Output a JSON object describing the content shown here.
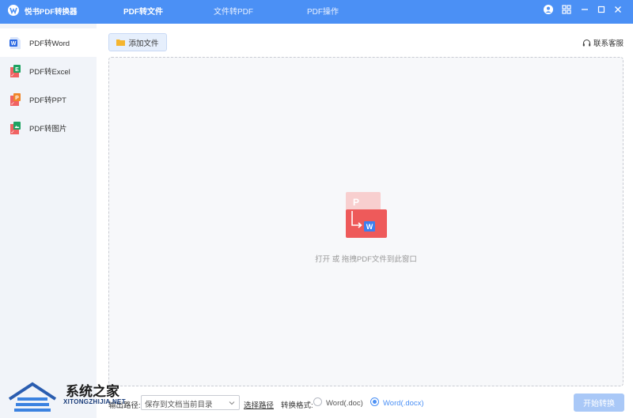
{
  "app": {
    "title": "悦书PDF转换器",
    "accent_color": "#4b90f5"
  },
  "tabs": [
    {
      "label": "PDF转文件",
      "active": true
    },
    {
      "label": "文件转PDF",
      "active": false
    },
    {
      "label": "PDF操作",
      "active": false
    }
  ],
  "window_controls": {
    "icons": [
      "avatar-icon",
      "grid-icon",
      "minimize-icon",
      "maximize-icon",
      "close-icon"
    ]
  },
  "sidebar": {
    "items": [
      {
        "label": "PDF转Word",
        "icon": "word-file-icon",
        "color": "#2d6ae3",
        "active": true
      },
      {
        "label": "PDF转Excel",
        "icon": "excel-file-icon",
        "color": "#1ea362",
        "active": false
      },
      {
        "label": "PDF转PPT",
        "icon": "ppt-file-icon",
        "color": "#f0862a",
        "active": false
      },
      {
        "label": "PDF转图片",
        "icon": "image-file-icon",
        "color": "#1ea362",
        "active": false
      }
    ]
  },
  "toolbar": {
    "add_file_label": "添加文件",
    "service_label": "联系客服"
  },
  "dropzone": {
    "hint": "打开 或 拖拽PDF文件到此窗口"
  },
  "bottom": {
    "output_path_label": "输出路径:",
    "output_path_value": "保存到文档当前目录",
    "choose_path_label": "选择路径",
    "format_label": "转换格式:",
    "formats": [
      {
        "label": "Word(.doc)",
        "checked": false
      },
      {
        "label": "Word(.docx)",
        "checked": true
      }
    ],
    "start_label": "开始转换"
  },
  "watermark": {
    "cn": "系统之家",
    "en": "XITONGZHIJIA.NET"
  }
}
